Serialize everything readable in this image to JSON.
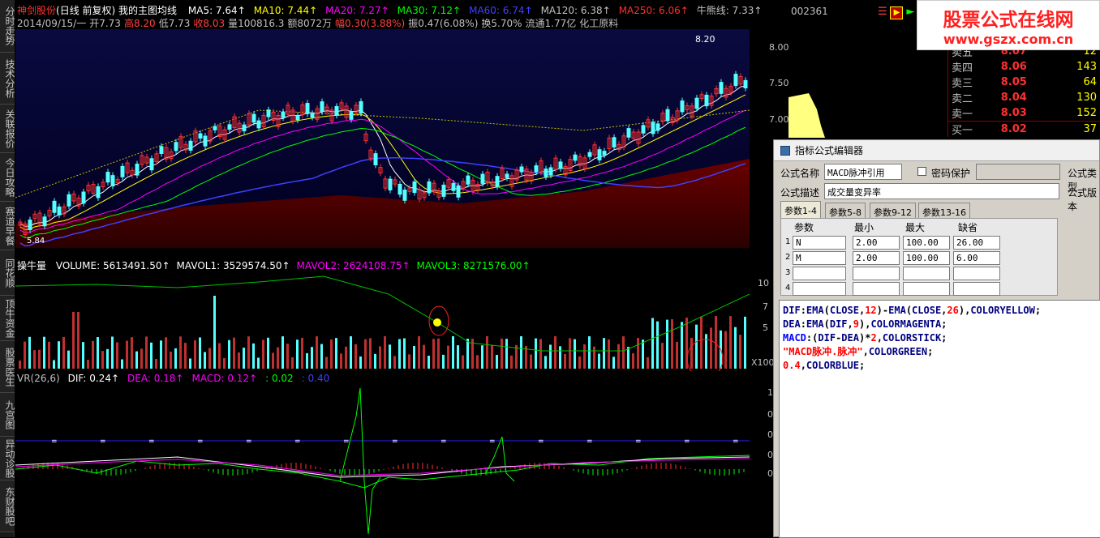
{
  "left_tabs": [
    "分时走势",
    "技术分析",
    "关联报价",
    "今日攻略",
    "赛道早餐",
    "同花顺",
    "顶牛资金",
    "股票医生",
    "九宫图",
    "异动诊股",
    "东财股吧"
  ],
  "header": {
    "stock_name": "神剑股份",
    "period": "(日线 前复权)",
    "indicator": "我的主图均线",
    "ma": [
      {
        "label": "MA5: 7.64",
        "color": "#ffffff"
      },
      {
        "label": "MA10: 7.44",
        "color": "#ffff00"
      },
      {
        "label": "MA20: 7.27",
        "color": "#ff00ff"
      },
      {
        "label": "MA30: 7.12",
        "color": "#00ff00"
      },
      {
        "label": "MA60: 6.74",
        "color": "#4040ff"
      },
      {
        "label": "MA120: 6.38",
        "color": "#c0c0c0"
      },
      {
        "label": "MA250: 6.06",
        "color": "#ff3030"
      },
      {
        "label": "牛熊线: 7.33",
        "color": "#c0c0c0"
      }
    ],
    "line2": [
      {
        "text": "2014/09/15/一",
        "color": "#c0c0c0"
      },
      {
        "text": "开7.73",
        "color": "#c0c0c0"
      },
      {
        "text": "高8.20",
        "color": "#ff4040"
      },
      {
        "text": "低7.73",
        "color": "#c0c0c0"
      },
      {
        "text": "收8.03",
        "color": "#ff4040"
      },
      {
        "text": "量100816.3",
        "color": "#c0c0c0"
      },
      {
        "text": "额8072万",
        "color": "#c0c0c0"
      },
      {
        "text": "幅0.30(3.88%)",
        "color": "#ff4040"
      },
      {
        "text": "振0.47(6.08%)",
        "color": "#c0c0c0"
      },
      {
        "text": "换5.70%",
        "color": "#c0c0c0"
      },
      {
        "text": "流通1.77亿",
        "color": "#c0c0c0"
      },
      {
        "text": "化工原料",
        "color": "#c0c0c0"
      }
    ]
  },
  "price_axis": [
    "8.00",
    "7.50",
    "7.00"
  ],
  "price_label_high": "8.20",
  "price_label_low": "5.84",
  "volume_pane": {
    "title": "操牛量",
    "items": [
      {
        "text": "VOLUME: 5613491.50",
        "color": "#ffffff"
      },
      {
        "text": "MAVOL1: 3529574.50",
        "color": "#ffffff"
      },
      {
        "text": "MAVOL2: 2624108.75",
        "color": "#ff00ff"
      },
      {
        "text": "MAVOL3: 8271576.00",
        "color": "#00ff00"
      }
    ],
    "axis": [
      "10",
      "7",
      "5"
    ],
    "multiplier": "X100"
  },
  "macd_pane": {
    "items": [
      {
        "text": "VR(26,6)",
        "color": "#c0c0c0"
      },
      {
        "text": "DIF: 0.24",
        "color": "#ffffff"
      },
      {
        "text": "DEA: 0.18",
        "color": "#ff00ff"
      },
      {
        "text": "MACD: 0.12",
        "color": "#ff00ff"
      },
      {
        "text": ": 0.02",
        "color": "#00ff00"
      },
      {
        "text": ": 0.40",
        "color": "#4040ff"
      }
    ],
    "axis": [
      "1",
      "0",
      "0",
      "0",
      "0"
    ]
  },
  "quote": {
    "code": "002361",
    "rows": [
      {
        "label": "卖五",
        "price": "8.07",
        "vol": "12"
      },
      {
        "label": "卖四",
        "price": "8.06",
        "vol": "143"
      },
      {
        "label": "卖三",
        "price": "8.05",
        "vol": "64"
      },
      {
        "label": "卖二",
        "price": "8.04",
        "vol": "130"
      },
      {
        "label": "卖一",
        "price": "8.03",
        "vol": "152"
      },
      {
        "label": "买一",
        "price": "8.02",
        "vol": "37"
      }
    ]
  },
  "watermark": {
    "title": "股票公式在线网",
    "url": "www.gszx.com.cn"
  },
  "editor": {
    "title": "指标公式编辑器",
    "name_label": "公式名称",
    "name_value": "MACD脉冲引用",
    "password_label": "密码保护",
    "type_label": "公式类型",
    "desc_label": "公式描述",
    "desc_value": "成交量变异率",
    "version_label": "公式版本",
    "tabs": [
      "参数1-4",
      "参数5-8",
      "参数9-12",
      "参数13-16"
    ],
    "param_headers": [
      "参数",
      "最小",
      "最大",
      "缺省"
    ],
    "params": [
      {
        "idx": "1",
        "name": "N",
        "min": "2.00",
        "max": "100.00",
        "default": "26.00"
      },
      {
        "idx": "2",
        "name": "M",
        "min": "2.00",
        "max": "100.00",
        "default": "6.00"
      },
      {
        "idx": "3",
        "name": "",
        "min": "",
        "max": "",
        "default": ""
      },
      {
        "idx": "4",
        "name": "",
        "min": "",
        "max": "",
        "default": ""
      }
    ],
    "code_lines": [
      "DIF:EMA(CLOSE,12)-EMA(CLOSE,26),COLORYELLOW;",
      "DEA:EMA(DIF,9),COLORMAGENTA;",
      "MACD:(DIF-DEA)*2,COLORSTICK;",
      "\"MACD脉冲.脉冲\",COLORGREEN;",
      "0.4,COLORBLUE;"
    ]
  },
  "colors": {
    "up": "#ff3030",
    "down": "#54ffff",
    "bg": "#000000",
    "border": "#8b0000"
  }
}
